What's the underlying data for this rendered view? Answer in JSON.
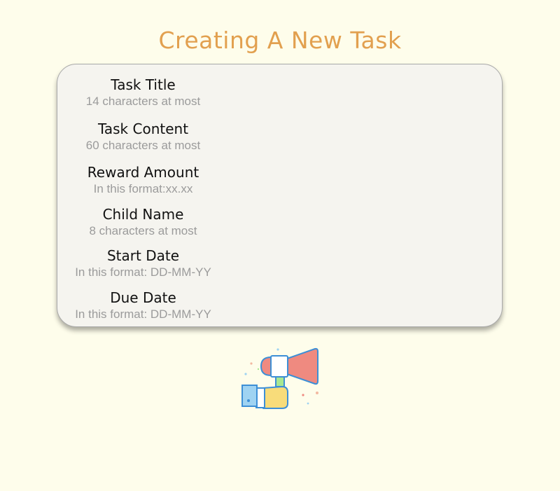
{
  "page": {
    "title": "Creating A New Task"
  },
  "form": {
    "fields": [
      {
        "label": "Task Title",
        "placeholder": "14 characters at most"
      },
      {
        "label": "Task Content",
        "placeholder": "60 characters at most"
      },
      {
        "label": "Reward Amount",
        "placeholder": "In this format:xx.xx"
      },
      {
        "label": "Child Name",
        "placeholder": "8 characters at most"
      },
      {
        "label": "Start Date",
        "placeholder": "In this format: DD-MM-YY"
      },
      {
        "label": "Due Date",
        "placeholder": "In this format: DD-MM-YY"
      }
    ]
  },
  "submit": {
    "icon": "megaphone-icon"
  },
  "colors": {
    "background": "#fefdeb",
    "title": "#e2a04f",
    "card": "#f5f4ef",
    "placeholder": "#9b9b9b",
    "megaphone_red": "#ef8a80",
    "megaphone_outline": "#3d8fd6",
    "sleeve_blue": "#9fd3f2",
    "hand_yellow": "#f8dc7a",
    "handle_green": "#a8e890"
  }
}
